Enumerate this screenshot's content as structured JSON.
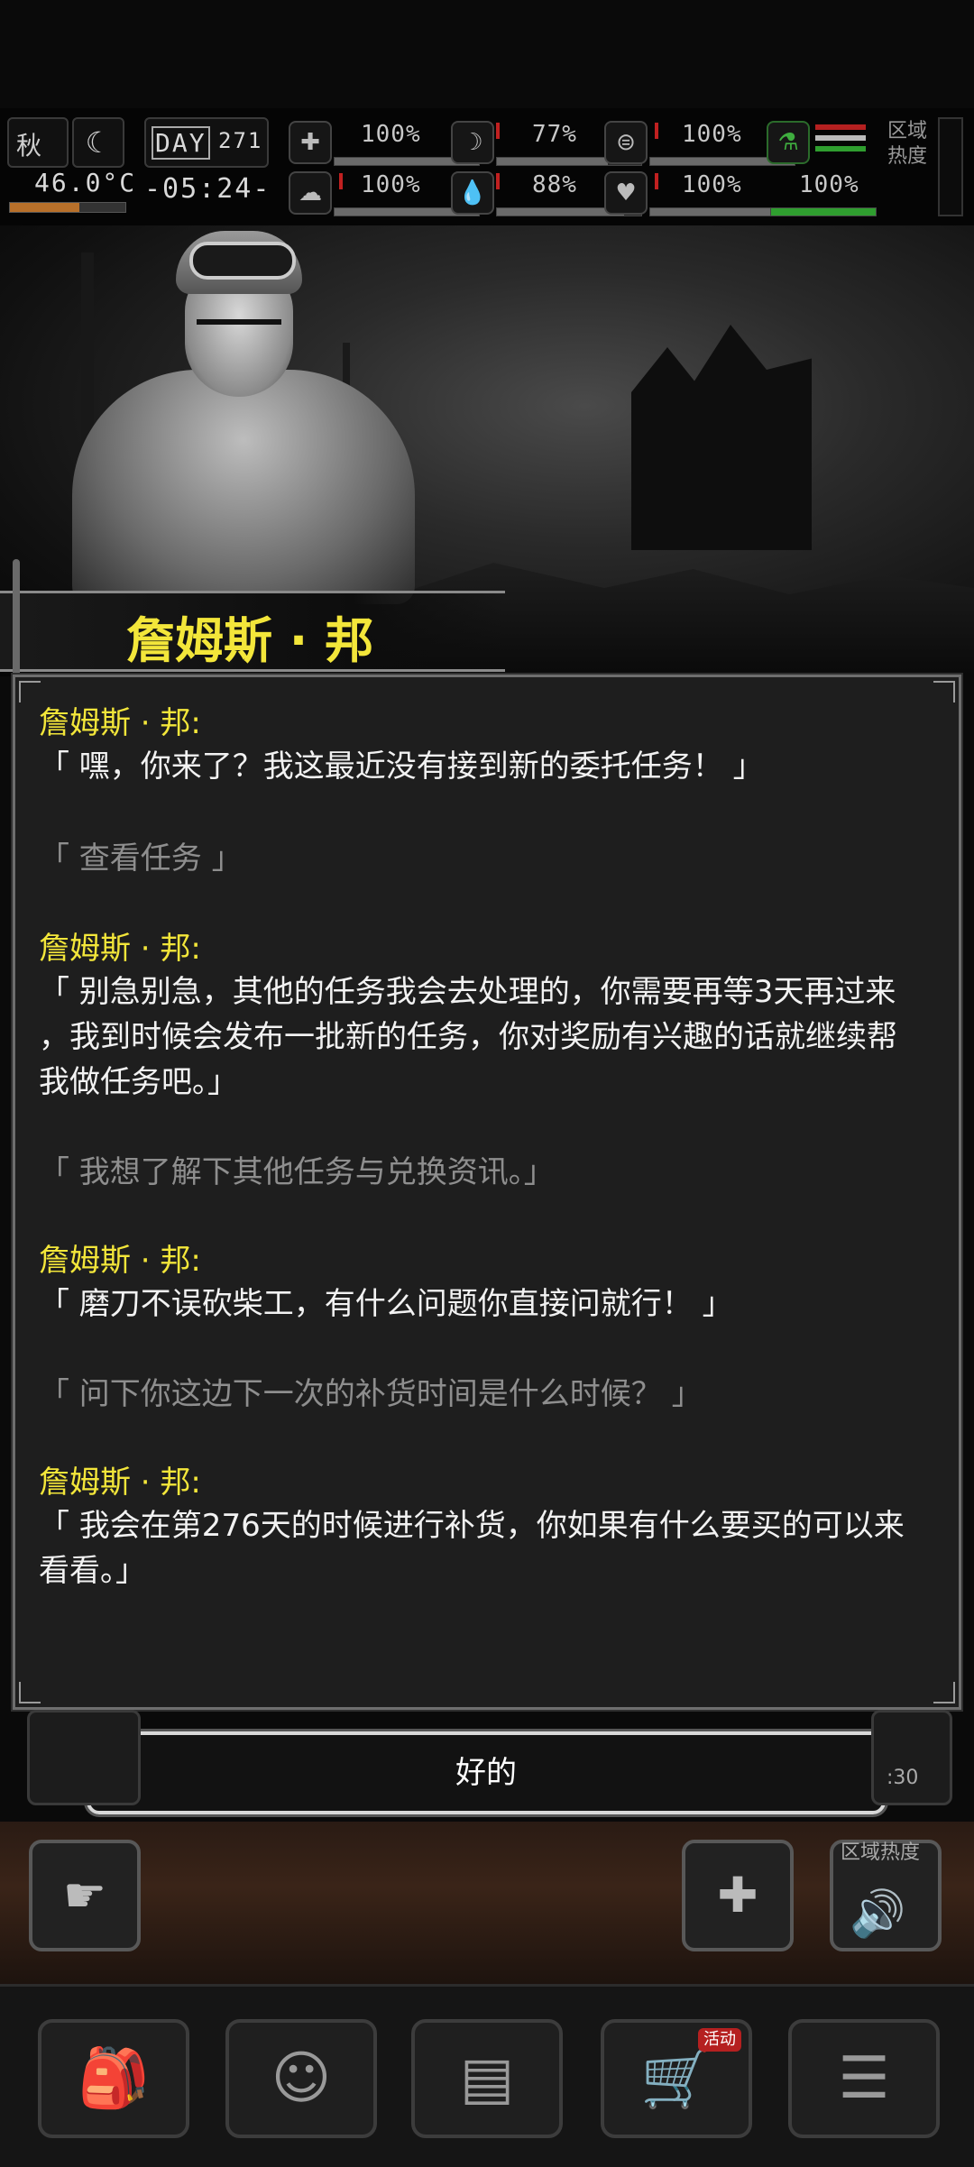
{
  "hud": {
    "season": "秋",
    "day_label": "DAY",
    "day_number": "271",
    "temperature": "46.0°C",
    "time": "-05:24-",
    "zone_heat_label": "区域热度",
    "stats": [
      {
        "name": "health",
        "icon": "medkit-icon",
        "value": "100%"
      },
      {
        "name": "hunger",
        "icon": "stomach-icon",
        "value": "77%"
      },
      {
        "name": "stamina",
        "icon": "stamina-icon",
        "value": "100%"
      },
      {
        "name": "mental",
        "icon": "brain-icon",
        "value": "100%"
      },
      {
        "name": "thirst",
        "icon": "water-drop-icon",
        "value": "88%"
      },
      {
        "name": "mood",
        "icon": "heart-icon",
        "value": "100%"
      },
      {
        "name": "extra",
        "icon": "flask-icon",
        "value": "100%"
      }
    ]
  },
  "npc": {
    "name": "詹姆斯 · 邦"
  },
  "dialog": {
    "lines": [
      {
        "type": "speaker",
        "text": "詹姆斯 · 邦:"
      },
      {
        "type": "speech",
        "text": "「 嘿，你来了？我这最近没有接到新的委托任务！ 」"
      },
      {
        "type": "option",
        "text": "「 查看任务 」"
      },
      {
        "type": "speaker",
        "text": "詹姆斯 · 邦:"
      },
      {
        "type": "speech",
        "text": "「 别急别急，其他的任务我会去处理的，你需要再等3天再过来"
      },
      {
        "type": "speech",
        "text": "，我到时候会发布一批新的任务，你对奖励有兴趣的话就继续帮"
      },
      {
        "type": "speech",
        "text": "我做任务吧。」"
      },
      {
        "type": "option",
        "text": "「 我想了解下其他任务与兑换资讯。」"
      },
      {
        "type": "speaker",
        "text": "詹姆斯 · 邦:"
      },
      {
        "type": "speech",
        "text": "「 磨刀不误砍柴工，有什么问题你直接问就行！ 」"
      },
      {
        "type": "option",
        "text": "「 问下你这边下一次的补货时间是什么时候？ 」"
      },
      {
        "type": "speaker",
        "text": "詹姆斯 · 邦:"
      },
      {
        "type": "speech",
        "text": "「 我会在第276天的时候进行补货，你如果有什么要买的可以来"
      },
      {
        "type": "speech",
        "text": "看看。」"
      }
    ]
  },
  "ok_button": "好的",
  "side": {
    "zone_heat_label": "区域热度",
    "timer_fragment": ":30"
  },
  "nav": {
    "badge_text": "活动"
  }
}
